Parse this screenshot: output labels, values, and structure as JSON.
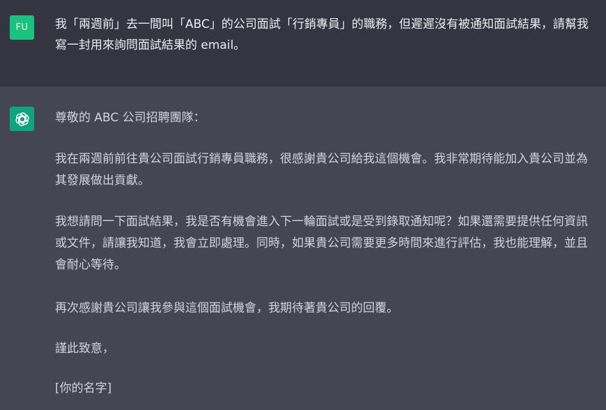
{
  "user": {
    "avatar_initials": "FU",
    "message": "我「兩週前」去一間叫「ABC」的公司面試「行銷專員」的職務，但遲遲沒有被通知面試結果，請幫我寫一封用來詢問面試結果的 email。"
  },
  "assistant": {
    "avatar_icon": "openai-logo-icon",
    "paragraphs": [
      "尊敬的 ABC 公司招聘團隊：",
      "我在兩週前前往貴公司面試行銷專員職務，很感謝貴公司給我這個機會。我非常期待能加入貴公司並為其發展做出貢獻。",
      "我想請問一下面試結果，我是否有機會進入下一輪面試或是受到錄取通知呢？如果還需要提供任何資訊或文件，請讓我知道，我會立即處理。同時，如果貴公司需要更多時間來進行評估，我也能理解，並且會耐心等待。",
      "再次感謝貴公司讓我參與這個面試機會，我期待著貴公司的回覆。",
      "謹此致意，",
      "[你的名字]"
    ]
  },
  "colors": {
    "user_bg": "#343541",
    "assistant_bg": "#444654",
    "user_avatar": "#19c37d",
    "bot_avatar": "#10a37f"
  }
}
